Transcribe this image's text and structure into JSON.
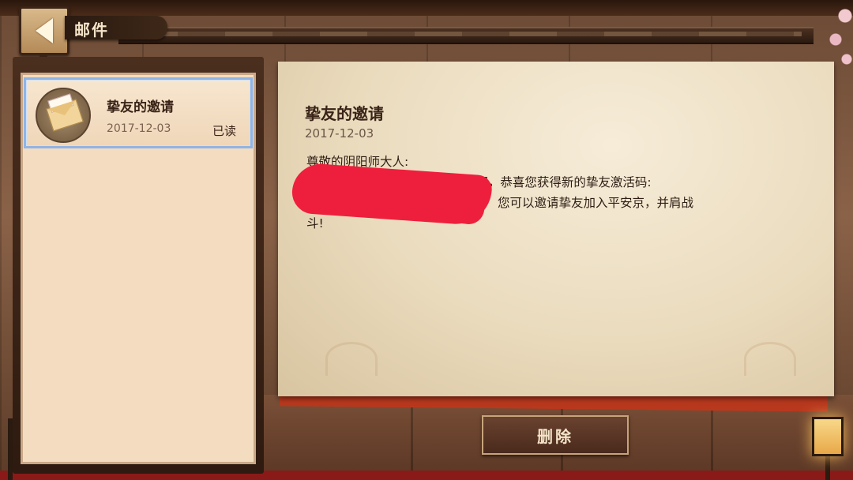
{
  "header": {
    "title": "邮件",
    "back_icon": "chevron-left-icon"
  },
  "mail_list": {
    "items": [
      {
        "icon": "envelope-icon",
        "title": "挚友的邀请",
        "date": "2017-12-03",
        "status": "已读"
      }
    ]
  },
  "letter": {
    "title": "挚友的邀请",
    "date": "2017-12-03",
    "body": {
      "greeting": "尊敬的阴阳师大人:",
      "line1": "您在活动期间已完成6场比赛，恭喜您获得新的挚友激活码:",
      "line2": "您可以邀请挚友加入平安京，并肩战",
      "line3": "斗!"
    }
  },
  "actions": {
    "delete_label": "删除"
  },
  "colors": {
    "accent_selected_border": "#8fb4e6",
    "redaction": "#ee1f3c",
    "paper": "#eadbbd"
  }
}
